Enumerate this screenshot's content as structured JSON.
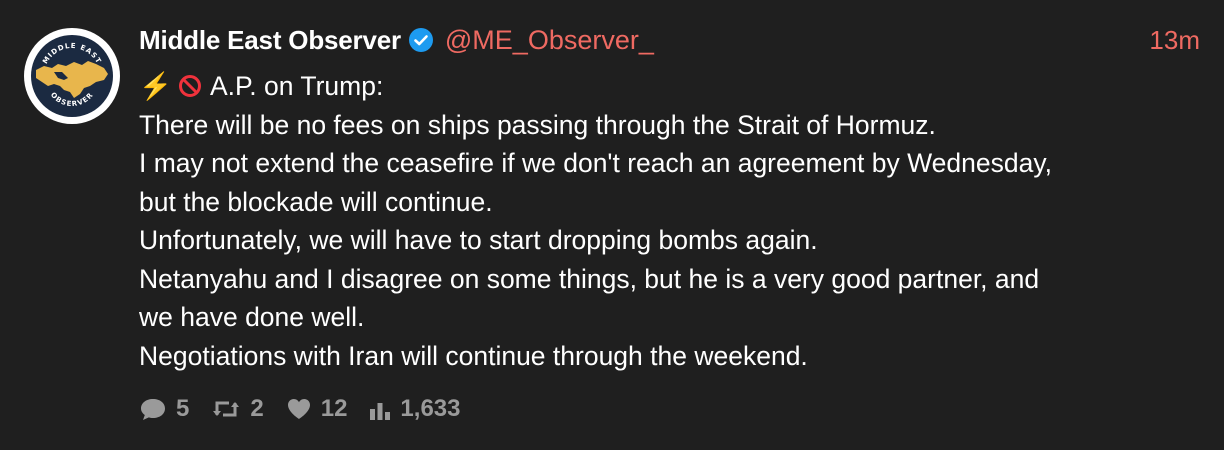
{
  "author": {
    "name": "Middle East Observer",
    "handle": "@ME_Observer_",
    "verified": true,
    "avatar_icon": "middle-east-observer-logo",
    "avatar_text_top": "MIDDLE EAST",
    "avatar_text_bottom": "OBSERVER"
  },
  "timestamp": "13m",
  "post": {
    "lead": "A.P. on Trump:",
    "lead_icons": [
      "high-voltage-emoji",
      "prohibited-emoji"
    ],
    "lines": [
      "There will be no fees on ships passing through the Strait of Hormuz.",
      "I may not extend the ceasefire if we don't reach an agreement by Wednesday,",
      "but the blockade will continue.",
      "Unfortunately, we will have to start dropping bombs again.",
      "Netanyahu and I disagree on some things, but he is a very good partner, and",
      "we have done well.",
      "Negotiations with Iran will continue through the weekend."
    ]
  },
  "stats": {
    "replies": "5",
    "reposts": "2",
    "likes": "12",
    "views": "1,633"
  },
  "colors": {
    "background": "#1f1f1f",
    "accent": "#ef6a62",
    "text": "#ffffff",
    "muted": "#9a9a9a",
    "verified": "#1d9bf0",
    "logo_navy": "#1b2a41",
    "logo_gold": "#e8b64c"
  }
}
